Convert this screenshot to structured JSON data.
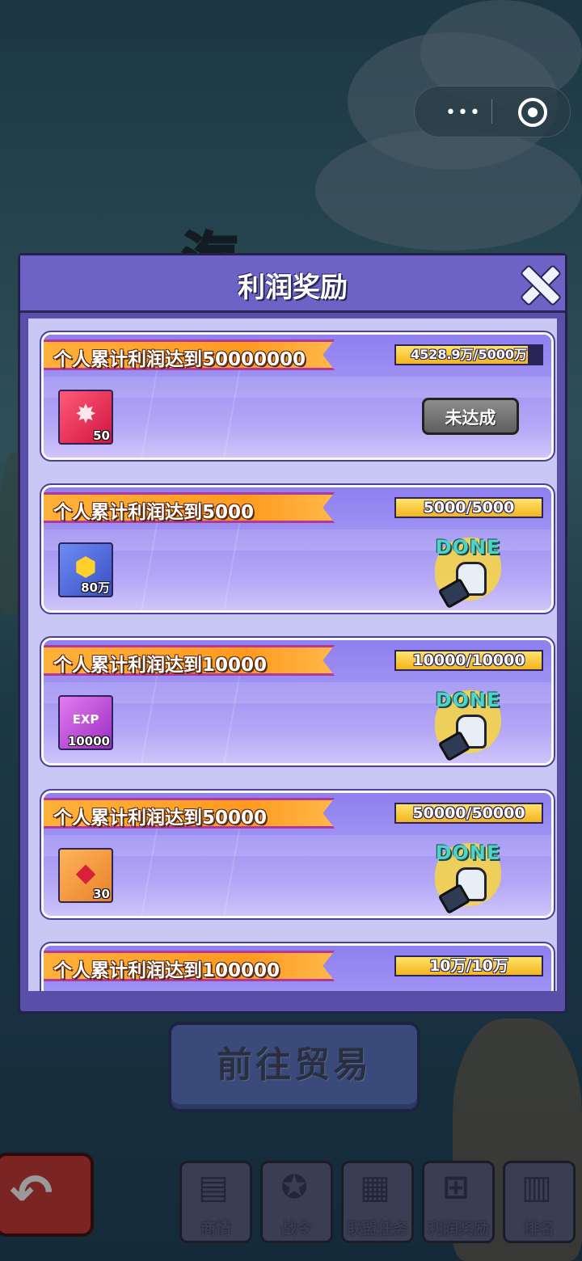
{
  "capsule": {
    "dots": "•••"
  },
  "dialog": {
    "title": "利润奖励",
    "rewards": [
      {
        "goal": "个人累计利润达到50000000",
        "progress": "4528.9万/5000万",
        "progress_fraction": 0.906,
        "item_icon": "red-badge-icon",
        "item_qty": "50",
        "status": "not_done",
        "status_label": "未达成"
      },
      {
        "goal": "个人累计利润达到5000",
        "progress": "5000/5000",
        "progress_fraction": 1.0,
        "item_icon": "gold-coins-icon",
        "item_qty": "80万",
        "status": "done",
        "status_label": "DONE"
      },
      {
        "goal": "个人累计利润达到10000",
        "progress": "10000/10000",
        "progress_fraction": 1.0,
        "item_icon": "exp-card-icon",
        "item_qty": "10000",
        "status": "done",
        "status_label": "DONE"
      },
      {
        "goal": "个人累计利润达到50000",
        "progress": "50000/50000",
        "progress_fraction": 1.0,
        "item_icon": "red-gem-icon",
        "item_qty": "30",
        "status": "done",
        "status_label": "DONE"
      },
      {
        "goal": "个人累计利润达到100000",
        "progress": "10万/10万",
        "progress_fraction": 1.0
      }
    ]
  },
  "go_trade_label": "前往贸易",
  "bottom_tabs": [
    {
      "label": "商情",
      "icon": "report-search-icon"
    },
    {
      "label": "战令",
      "icon": "medal-icon"
    },
    {
      "label": "联盟任务",
      "icon": "calendar-check-icon"
    },
    {
      "label": "利润奖励",
      "icon": "gift-icon"
    },
    {
      "label": "排名",
      "icon": "bar-chart-icon"
    }
  ],
  "colors": {
    "dialog": "#5a4fa8",
    "banner": "#ffa126",
    "progress_fill": "#f3b51f",
    "done_text": "#4fd3c9"
  }
}
